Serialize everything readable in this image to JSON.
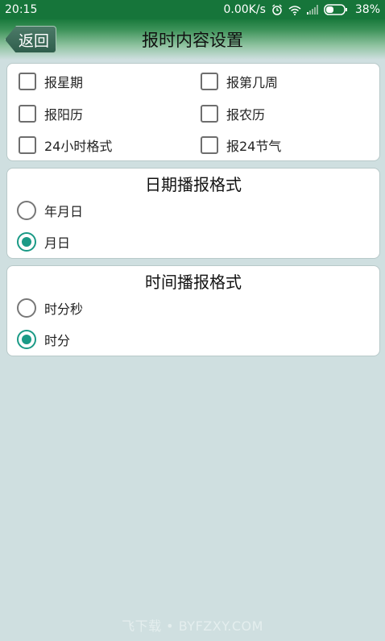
{
  "status_bar": {
    "time": "20:15",
    "net_speed": "0.00K/s",
    "battery": "38%",
    "icons": [
      "alarm-icon",
      "wifi-icon",
      "signal-icon",
      "battery-icon"
    ]
  },
  "header": {
    "back_label": "返回",
    "title": "报时内容设置"
  },
  "options": {
    "items": [
      {
        "label": "报星期",
        "checked": false
      },
      {
        "label": "报第几周",
        "checked": false
      },
      {
        "label": "报阳历",
        "checked": false
      },
      {
        "label": "报农历",
        "checked": false
      },
      {
        "label": "24小时格式",
        "checked": false
      },
      {
        "label": "报24节气",
        "checked": false
      }
    ]
  },
  "date_format": {
    "title": "日期播报格式",
    "options": [
      {
        "label": "年月日",
        "selected": false
      },
      {
        "label": "月日",
        "selected": true
      }
    ]
  },
  "time_format": {
    "title": "时间播报格式",
    "options": [
      {
        "label": "时分秒",
        "selected": false
      },
      {
        "label": "时分",
        "selected": true
      }
    ]
  },
  "watermark": "飞下载 • BYFZXY.COM",
  "colors": {
    "status_bar": "#16753a",
    "radio_accent": "#1a9a86",
    "background": "#cfdfe0"
  }
}
